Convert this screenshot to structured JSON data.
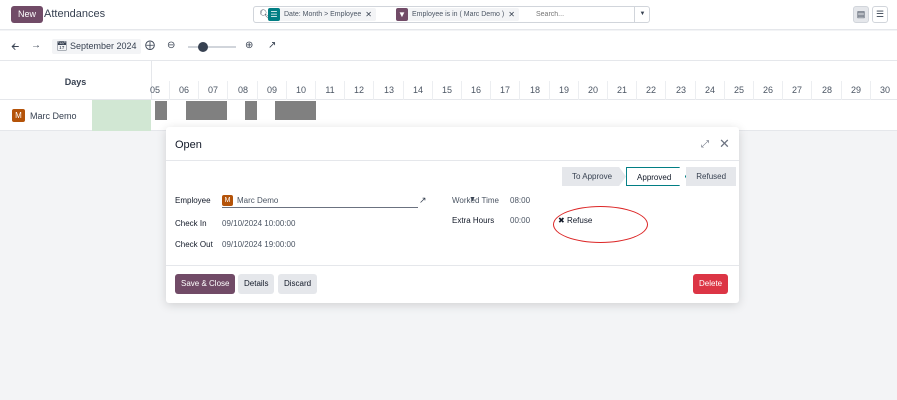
{
  "topbar": {
    "new_label": "New",
    "title": "Attendances",
    "search": {
      "facets": [
        {
          "icon": "group-by-icon",
          "icon_color": "#017e84",
          "text": "Date: Month > Employee"
        },
        {
          "icon": "filter-icon",
          "icon_color": "#714b67",
          "text": "Employee is in ( Marc Demo )"
        }
      ],
      "placeholder": "Search..."
    }
  },
  "toolbar": {
    "date_label": "September 2024"
  },
  "gantt": {
    "days_header": "Days",
    "day_numbers": [
      "05",
      "06",
      "07",
      "08",
      "09",
      "10",
      "11",
      "12",
      "13",
      "14",
      "15",
      "16",
      "17",
      "18",
      "19",
      "20",
      "21",
      "22",
      "23",
      "24",
      "25",
      "26",
      "27",
      "28",
      "29",
      "30"
    ],
    "weekend_days": [
      "07",
      "08",
      "14",
      "15",
      "21",
      "22",
      "28",
      "29"
    ],
    "employee": {
      "name": "Marc Demo",
      "avatar_initial": "M"
    }
  },
  "modal": {
    "title": "Open",
    "stages": [
      {
        "label": "To Approve",
        "current": false
      },
      {
        "label": "Approved",
        "current": true
      },
      {
        "label": "Refused",
        "current": false
      }
    ],
    "fields": {
      "employee_label": "Employee",
      "employee_value": "Marc Demo",
      "check_in_label": "Check In",
      "check_in_value": "09/10/2024 10:00:00",
      "check_out_label": "Check Out",
      "check_out_value": "09/10/2024 19:00:00",
      "worked_time_label": "Worked Time",
      "worked_time_value": "08:00",
      "extra_hours_label": "Extra Hours",
      "extra_hours_value": "00:00"
    },
    "refuse_label": "Refuse",
    "buttons": {
      "save_close": "Save & Close",
      "details": "Details",
      "discard": "Discard",
      "delete": "Delete"
    }
  },
  "colors": {
    "brand": "#714b67",
    "accent": "#017e84",
    "danger": "#dc3545",
    "annotation": "#dc2626"
  }
}
